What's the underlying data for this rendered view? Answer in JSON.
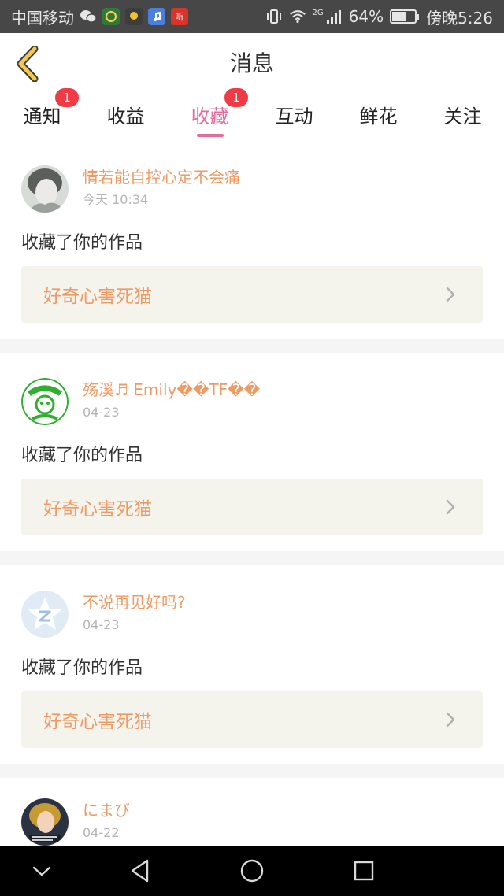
{
  "status_bar": {
    "carrier": "中国移动",
    "network": "2G",
    "battery": "64%",
    "battery_level": 0.64,
    "time": "傍晚5:26",
    "app_icons": [
      "wechat-icon",
      "app-icon-green",
      "app-icon-yellow",
      "music-app-icon",
      "ting-app-icon"
    ],
    "ting_label": "听"
  },
  "header": {
    "title": "消息",
    "accent": "#e46b9c"
  },
  "tabs": [
    {
      "label": "通知",
      "badge": "1",
      "active": false
    },
    {
      "label": "收益",
      "badge": "",
      "active": false
    },
    {
      "label": "收藏",
      "badge": "1",
      "active": true
    },
    {
      "label": "互动",
      "badge": "",
      "active": false
    },
    {
      "label": "鲜花",
      "badge": "",
      "active": false
    },
    {
      "label": "关注",
      "badge": "",
      "active": false
    }
  ],
  "feed": [
    {
      "username": "情若能自控心定不会痛",
      "time": "今天 10:34",
      "action": "收藏了你的作品",
      "work": "好奇心害死猫",
      "avatar": "avatar-girl"
    },
    {
      "username": "殇溪♬ Emily��TF��",
      "time": "04-23",
      "action": "收藏了你的作品",
      "work": "好奇心害死猫",
      "avatar": "avatar-green-badge"
    },
    {
      "username": "不说再见好吗?",
      "time": "04-23",
      "action": "收藏了你的作品",
      "work": "好奇心害死猫",
      "avatar": "avatar-qq-star"
    },
    {
      "username": "にまび",
      "time": "04-22",
      "action": "",
      "work": "",
      "avatar": "avatar-cartoon"
    }
  ],
  "colors": {
    "username": "#ef9a63",
    "badge": "#f03a45",
    "work_box": "#f4f3ec"
  }
}
